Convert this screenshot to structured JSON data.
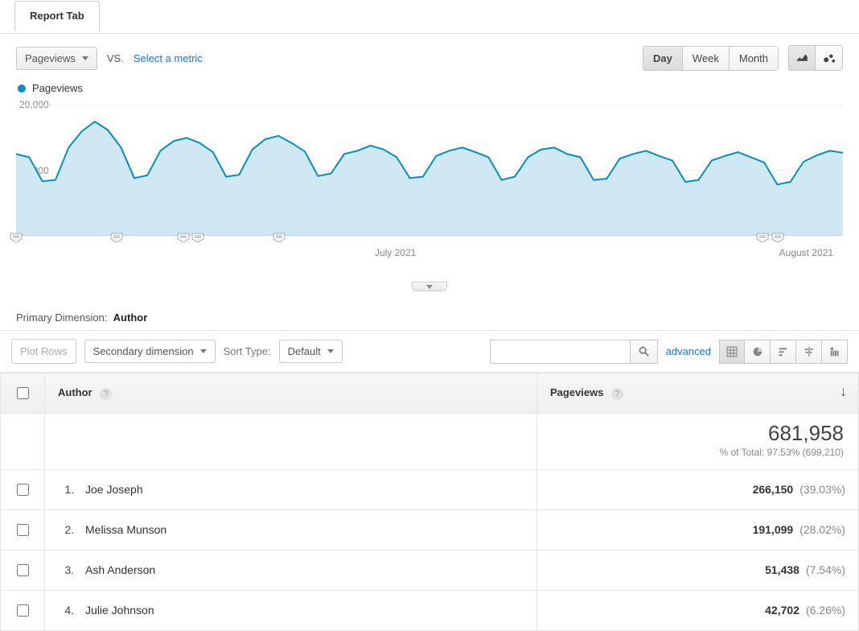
{
  "tab_label": "Report Tab",
  "metric_selector": "Pageviews",
  "vs_label": "VS.",
  "compare_link": "Select a metric",
  "granularity": {
    "options": [
      "Day",
      "Week",
      "Month"
    ],
    "active": "Day"
  },
  "legend": {
    "label": "Pageviews"
  },
  "primary_dimension_prefix": "Primary Dimension:",
  "primary_dimension_value": "Author",
  "plot_rows_btn": "Plot Rows",
  "secondary_dim_btn": "Secondary dimension",
  "sort_type_label": "Sort Type:",
  "sort_type_value": "Default",
  "advanced_link": "advanced",
  "columns": {
    "dim": "Author",
    "metric": "Pageviews"
  },
  "totals": {
    "value": "681,958",
    "subtext": "% of Total: 97.53% (699,210)"
  },
  "rows": [
    {
      "n": "1.",
      "name": "Joe Joseph",
      "value": "266,150",
      "pct": "(39.03%)"
    },
    {
      "n": "2.",
      "name": "Melissa Munson",
      "value": "191,099",
      "pct": "(28.02%)"
    },
    {
      "n": "3.",
      "name": "Ash Anderson",
      "value": "51,438",
      "pct": "(7.54%)"
    },
    {
      "n": "4.",
      "name": "Julie Johnson",
      "value": "42,702",
      "pct": "(6.26%)"
    }
  ],
  "chart_data": {
    "type": "area",
    "xlabel": "",
    "ylabel": "",
    "ylim": [
      0,
      20000
    ],
    "yticks": [
      "20,000",
      "10,000"
    ],
    "xticks": [
      {
        "label": "July 2021",
        "frac": 0.463
      },
      {
        "label": "August 2021",
        "frac": 0.952
      }
    ],
    "annotations_frac": [
      0.0,
      0.122,
      0.202,
      0.22,
      0.318,
      0.903,
      0.921
    ],
    "title": "Pageviews",
    "series": [
      {
        "name": "Pageviews",
        "color": "#058dc7",
        "values": [
          12500,
          12000,
          8300,
          8500,
          13500,
          16000,
          17500,
          16200,
          13500,
          8800,
          9200,
          13000,
          14500,
          15000,
          14200,
          12800,
          9000,
          9300,
          13200,
          14800,
          15300,
          14200,
          12900,
          9100,
          9500,
          12500,
          13000,
          13800,
          13200,
          12000,
          8800,
          9000,
          12200,
          13000,
          13500,
          12800,
          12000,
          8500,
          9000,
          12000,
          13200,
          13500,
          12500,
          12000,
          8500,
          8700,
          11800,
          12500,
          13000,
          12200,
          11500,
          8200,
          8500,
          11500,
          12200,
          12800,
          12000,
          11200,
          7800,
          8200,
          11300,
          12300,
          13000,
          12700
        ]
      }
    ]
  }
}
